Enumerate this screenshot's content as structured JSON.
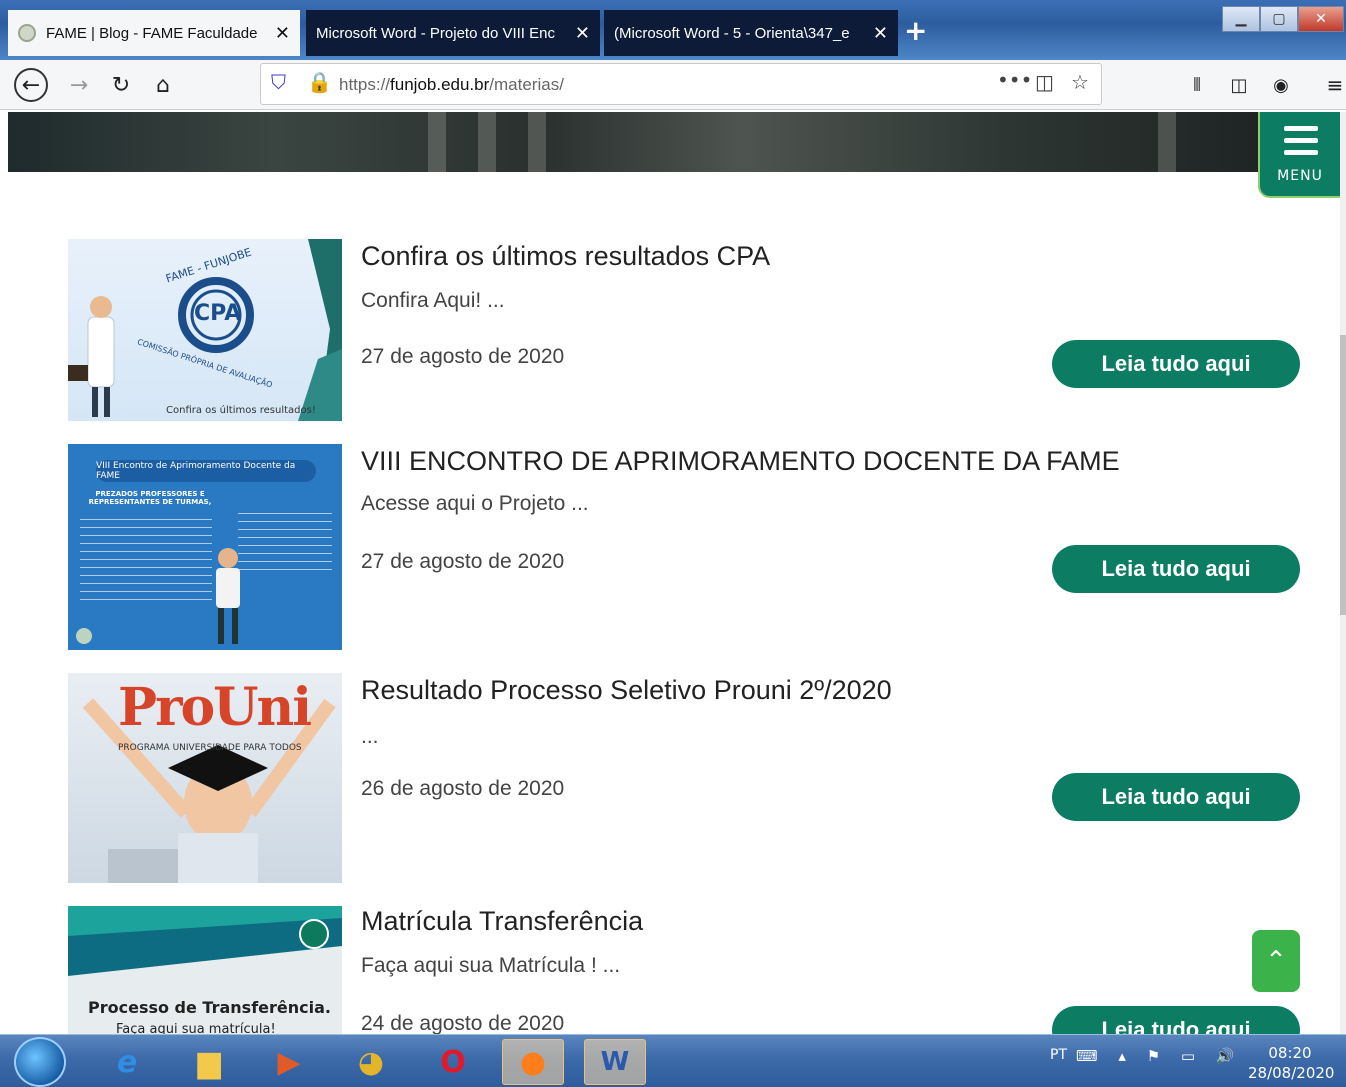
{
  "browser": {
    "tabs": [
      {
        "label": "FAME | Blog - FAME Faculdade"
      },
      {
        "label": "Microsoft Word - Projeto do VIII Enc"
      },
      {
        "label": "(Microsoft Word - 5 - Orienta\\347_e"
      }
    ],
    "url_prefix": "https://",
    "url_domain": "funjob.edu.br",
    "url_path": "/materias/"
  },
  "site": {
    "menu_label": "MENU"
  },
  "posts": [
    {
      "title": "Confira os últimos resultados CPA",
      "excerpt": "Confira Aqui! ...",
      "date": "27 de agosto de 2020",
      "button": "Leia tudo aqui",
      "thumb_caption": "Confira os últimos resultados!",
      "thumb_logo": "CPA",
      "thumb_ring_top": "FAME - FUNJOBE",
      "thumb_ring_bottom": "COMISSÃO PRÓPRIA DE AVALIAÇÃO"
    },
    {
      "title": "VIII ENCONTRO DE APRIMORAMENTO DOCENTE DA FAME",
      "excerpt": "Acesse aqui o Projeto ...",
      "date": "27 de agosto de 2020",
      "button": "Leia tudo aqui",
      "thumb_banner": "VIII Encontro de Aprimoramento Docente da FAME",
      "thumb_heading": "PREZADOS PROFESSORES E REPRESENTANTES DE TURMAS,"
    },
    {
      "title": "Resultado Processo Seletivo Prouni 2º/2020",
      "excerpt": "...",
      "date": "26 de agosto de 2020",
      "button": "Leia tudo aqui",
      "thumb_logo": "ProUni",
      "thumb_sub": "PROGRAMA UNIVERSIDADE PARA TODOS"
    },
    {
      "title": "Matrícula Transferência",
      "excerpt": "Faça aqui sua Matrícula ! ...",
      "date": "24 de agosto de 2020",
      "button": "Leia tudo aqui",
      "thumb_title": "Processo de Transferência.",
      "thumb_sub": "Faça aqui sua matrícula!"
    }
  ],
  "taskbar": {
    "lang": "PT",
    "time": "08:20",
    "date": "28/08/2020"
  }
}
